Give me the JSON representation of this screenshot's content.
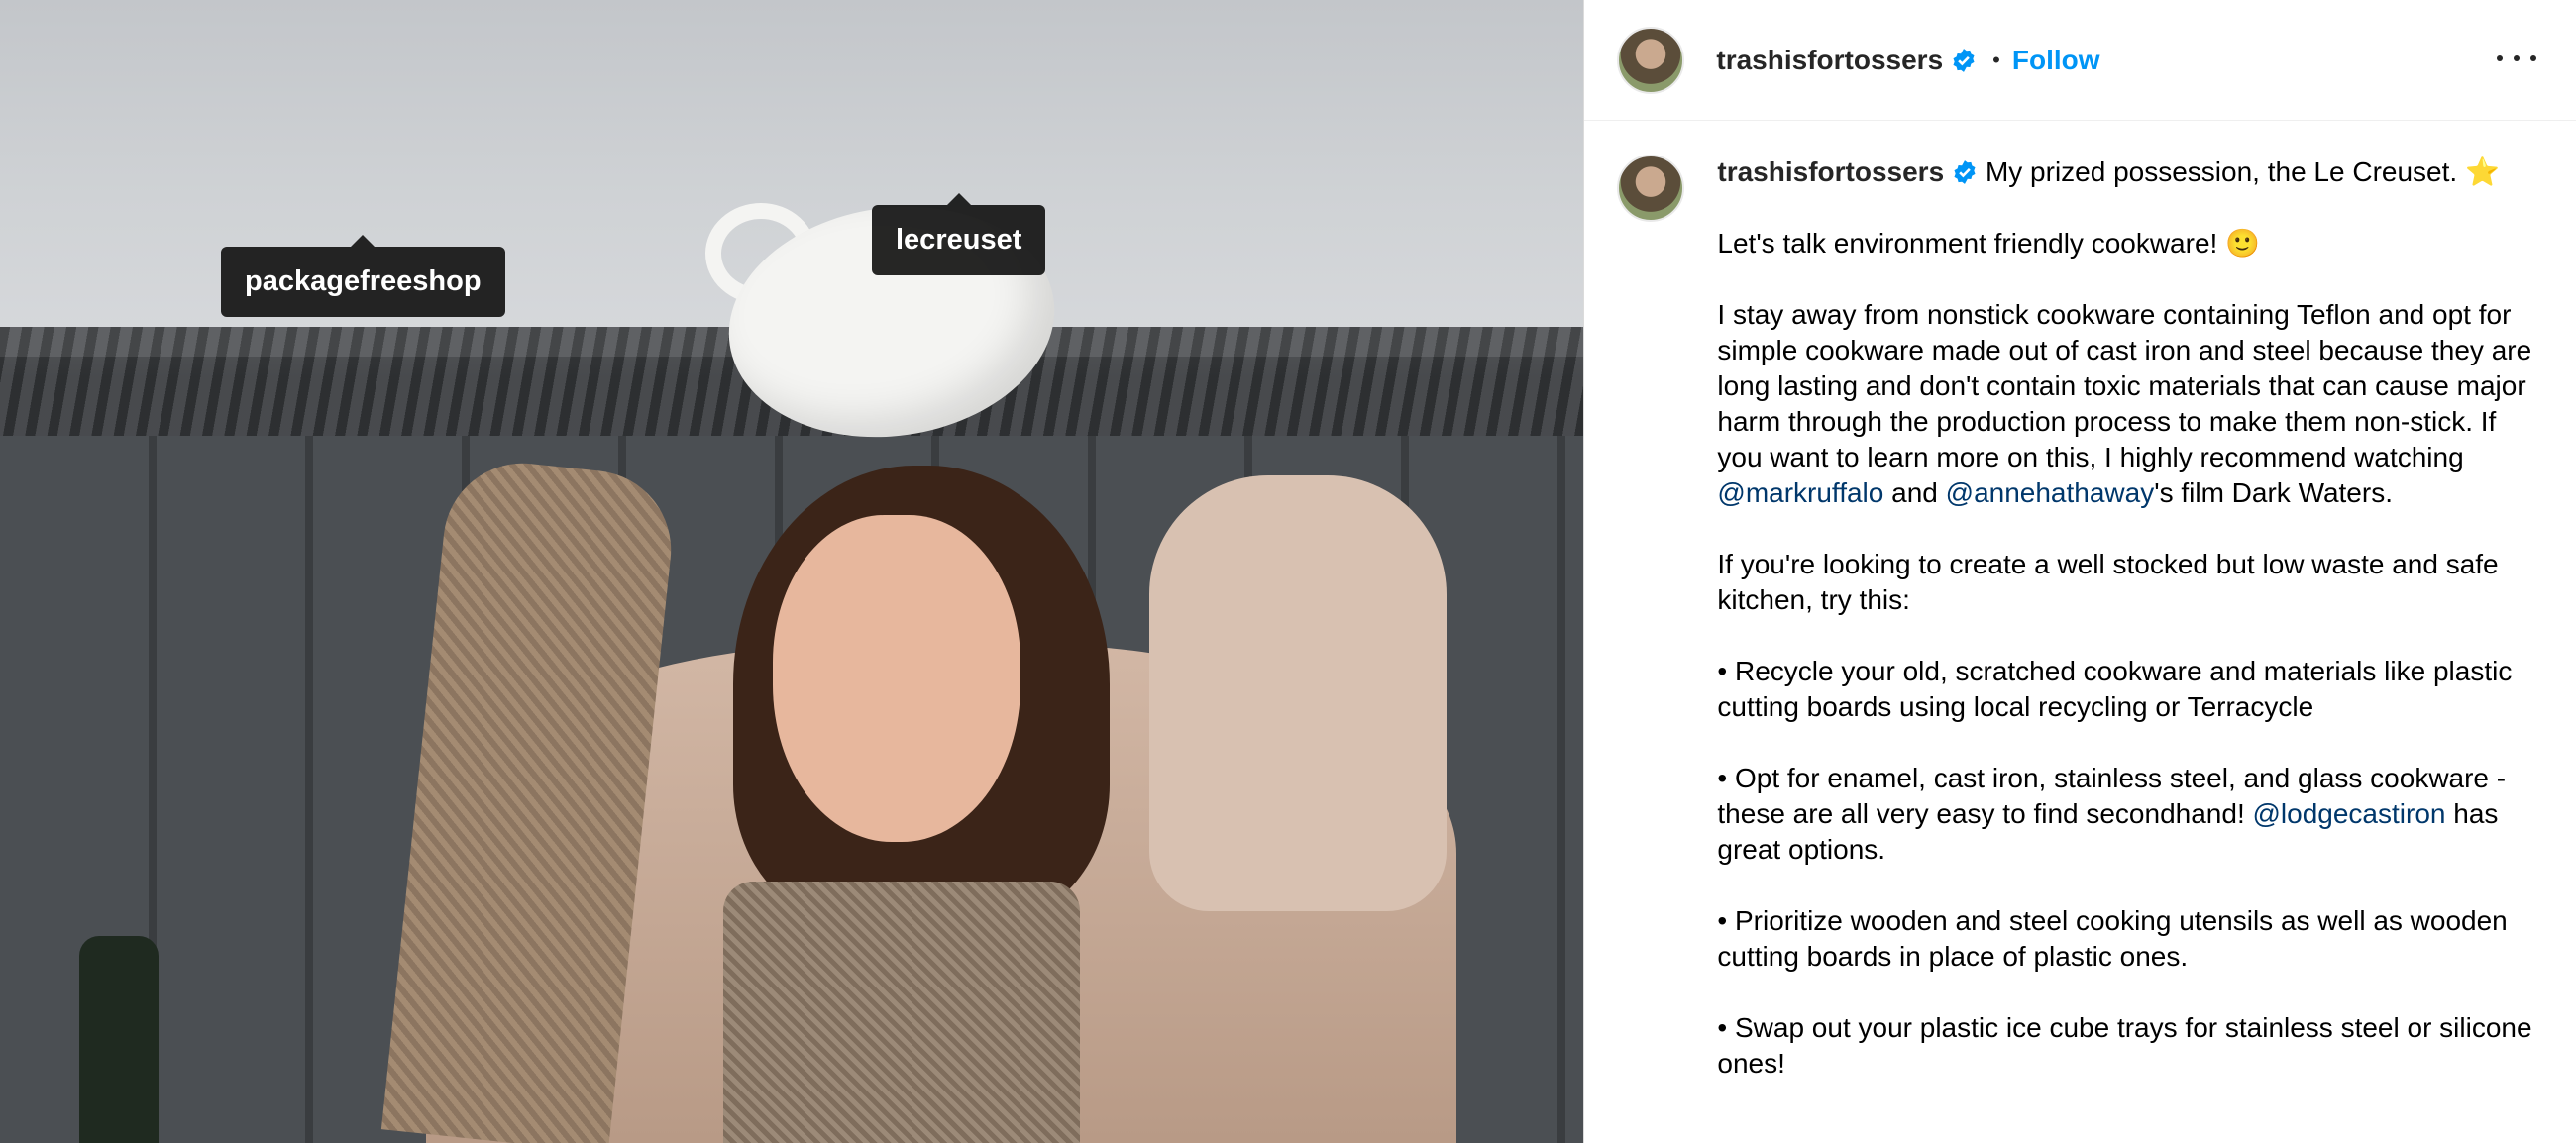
{
  "photo": {
    "tags": [
      {
        "label": "packagefreeshop"
      },
      {
        "label": "lecreuset"
      }
    ]
  },
  "header": {
    "username": "trashisfortossers",
    "separator": "•",
    "follow_label": "Follow",
    "icons": [
      "verified-badge-icon",
      "more-options-icon"
    ]
  },
  "caption": {
    "username": "trashisfortossers",
    "first_line": "My prized possession, the Le Creuset. ⭐️",
    "p1": "Let's talk environment friendly cookware! 🙂",
    "p2_before": "I stay away from nonstick cookware containing Teflon and opt for simple cookware made out of cast iron and steel because they are long lasting and don't contain toxic materials that can cause major harm through the production process to make them non-stick. If you want to learn more on this, I highly recommend watching ",
    "p2_mention1": "@markruffalo",
    "p2_and": " and ",
    "p2_mention2": "@annehathaway",
    "p2_after": "'s film Dark Waters.",
    "p3": "If you're looking to create a well stocked but low waste and safe kitchen, try this:",
    "p4": "• Recycle your old, scratched cookware and materials like plastic cutting boards using local recycling or Terracycle",
    "p5_before": "• Opt for enamel, cast iron, stainless steel, and glass cookware - these are all very easy to find secondhand! ",
    "p5_mention": "@lodgecastiron",
    "p5_after": " has great options.",
    "p6": "• Prioritize wooden and steel cooking utensils as well as wooden cutting boards in place of plastic ones.",
    "p7": "• Swap out your plastic ice cube trays for stainless steel or silicone ones!"
  },
  "colors": {
    "follow": "#0095f6",
    "mention": "#00376b",
    "verified": "#0095f6"
  }
}
